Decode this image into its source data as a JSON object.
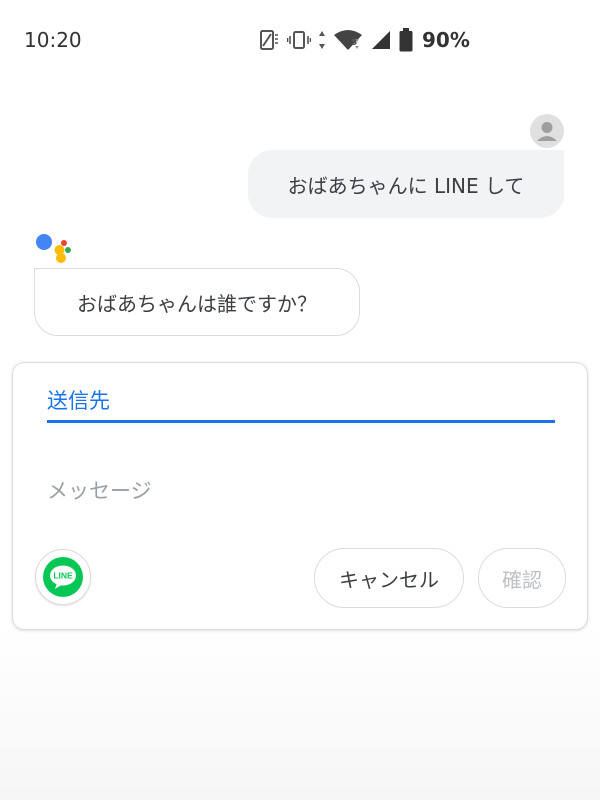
{
  "status_bar": {
    "time": "10:20",
    "battery_percent": "90%",
    "network_badge": "5",
    "icons": [
      "screen-rotate-icon",
      "vibrate-icon",
      "data-arrows-icon",
      "wifi-icon",
      "signal-icon",
      "battery-icon"
    ]
  },
  "conversation": {
    "user_message": "おばあちゃんに LINE して",
    "assistant_message": "おばあちゃんは誰ですか？"
  },
  "form": {
    "recipient_label": "送信先",
    "message_placeholder": "メッセージ",
    "app_name": "LINE",
    "cancel_label": "キャンセル",
    "confirm_label": "確認"
  },
  "colors": {
    "accent": "#1a73e8",
    "line_green": "#06c755",
    "assistant_blue": "#4285f4",
    "assistant_red": "#ea4335",
    "assistant_yellow": "#fbbc04",
    "assistant_green": "#34a853"
  }
}
